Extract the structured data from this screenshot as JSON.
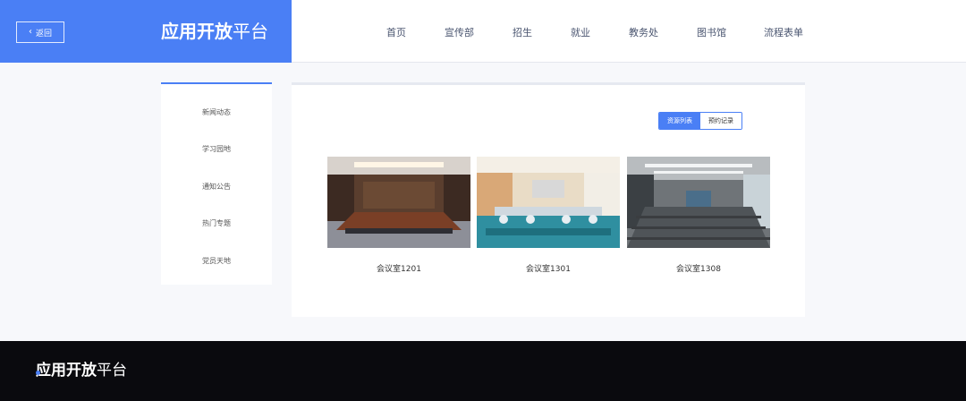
{
  "header": {
    "back_label": "返回",
    "brand_bold": "应用开放",
    "brand_light": "平台",
    "nav": [
      "首页",
      "宣传部",
      "招生",
      "就业",
      "教务处",
      "图书馆",
      "流程表单"
    ]
  },
  "sidebar": {
    "items": [
      "新闻动态",
      "学习园地",
      "通知公告",
      "热门专题",
      "党员天地"
    ]
  },
  "main": {
    "tabs": [
      "资源列表",
      "预约记录"
    ],
    "active_tab": "资源列表",
    "rooms": [
      {
        "name": "会议室1201"
      },
      {
        "name": "会议室1301"
      },
      {
        "name": "会议室1308"
      }
    ]
  },
  "footer": {
    "brand_bold": "应用开放",
    "brand_light": "平台"
  },
  "colors": {
    "accent": "#4a7ff5",
    "footer_bg": "#0a0a0e"
  }
}
